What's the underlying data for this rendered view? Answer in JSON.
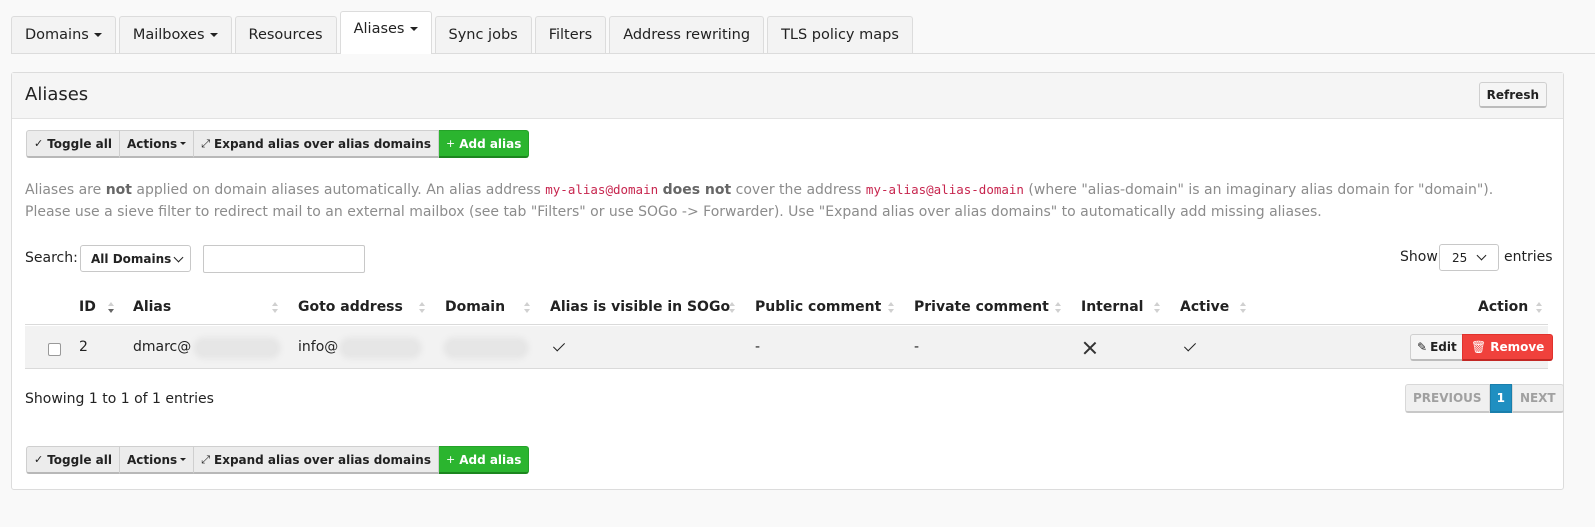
{
  "tabs": [
    {
      "label": "Domains",
      "dropdown": true
    },
    {
      "label": "Mailboxes",
      "dropdown": true
    },
    {
      "label": "Resources",
      "dropdown": false
    },
    {
      "label": "Aliases",
      "dropdown": true,
      "active": true
    },
    {
      "label": "Sync jobs",
      "dropdown": false
    },
    {
      "label": "Filters",
      "dropdown": false
    },
    {
      "label": "Address rewriting",
      "dropdown": false
    },
    {
      "label": "TLS policy maps",
      "dropdown": false
    }
  ],
  "panel": {
    "title": "Aliases",
    "refresh_label": "Refresh"
  },
  "toolbar": {
    "toggle_all": "Toggle all",
    "actions": "Actions",
    "expand": "Expand alias over alias domains",
    "add_alias": "Add alias"
  },
  "notice": {
    "l1_a": "Aliases are ",
    "l1_b": "not",
    "l1_c": " applied on domain aliases automatically. An alias address ",
    "l1_code1": "my-alias@domain",
    "l1_d": " ",
    "l1_e": "does not",
    "l1_f": " cover the address ",
    "l1_code2": "my-alias@alias-domain",
    "l1_g": " (where \"alias-domain\" is an imaginary alias domain for \"domain\").",
    "l2": "Please use a sieve filter to redirect mail to an external mailbox (see tab \"Filters\" or use SOGo -> Forwarder). Use \"Expand alias over alias domains\" to automatically add missing aliases."
  },
  "table_controls": {
    "search_label": "Search:",
    "domain_filter": "All Domains",
    "search_value": "",
    "show_label": "Show",
    "page_size": "25",
    "entries_label": "entries"
  },
  "table": {
    "columns": [
      "ID",
      "Alias",
      "Goto address",
      "Domain",
      "Alias is visible in SOGo",
      "Public comment",
      "Private comment",
      "Internal",
      "Active",
      "Action"
    ],
    "rows": [
      {
        "id": "2",
        "alias": "dmarc@",
        "goto": "info@",
        "sogo_visible": true,
        "public_comment": "-",
        "private_comment": "-",
        "internal": false,
        "active": true,
        "edit_label": "Edit",
        "remove_label": "Remove"
      }
    ]
  },
  "footer": {
    "showing": "Showing 1 to 1 of 1 entries",
    "prev": "PREVIOUS",
    "page": "1",
    "next": "NEXT"
  },
  "colors": {
    "add_green": "#2bb52f",
    "remove_red": "#f0413c",
    "page_blue": "#1f8fc1",
    "code_pink": "#c7254e"
  }
}
